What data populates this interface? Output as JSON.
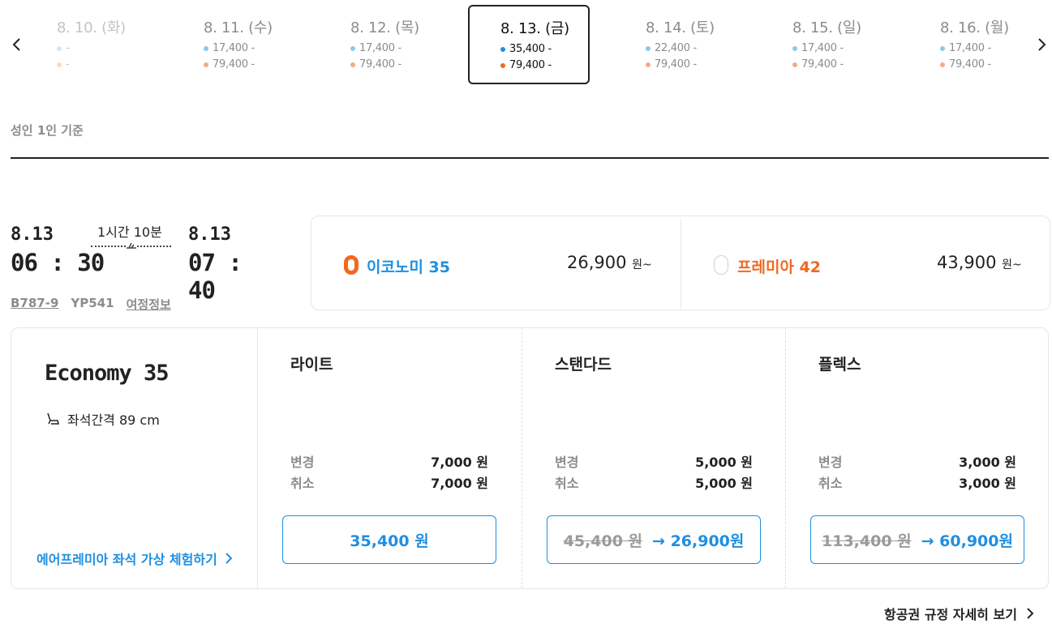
{
  "date_strip": {
    "dates": [
      {
        "label": "8. 10. (화)",
        "price1": "-",
        "price2": "-"
      },
      {
        "label": "8. 11. (수)",
        "price1": "17,400 -",
        "price2": "79,400 -"
      },
      {
        "label": "8. 12. (목)",
        "price1": "17,400 -",
        "price2": "79,400 -"
      },
      {
        "label": "8. 13. (금)",
        "price1": "35,400 -",
        "price2": "79,400 -"
      },
      {
        "label": "8. 14. (토)",
        "price1": "22,400 -",
        "price2": "79,400 -"
      },
      {
        "label": "8. 15. (일)",
        "price1": "17,400 -",
        "price2": "79,400 -"
      },
      {
        "label": "8. 16. (월)",
        "price1": "17,400 -",
        "price2": "79,400 -"
      }
    ],
    "selected_index": 3
  },
  "basis": "성인 1인 기준",
  "flight": {
    "dep_date": "8.13",
    "dep_time": "06 : 30",
    "arr_date": "8.13",
    "arr_time": "07 : 40",
    "duration": "1시간 10분",
    "aircraft": "B787-9",
    "flight_no": "YP541",
    "itinerary_link": "여정정보"
  },
  "classes": {
    "economy": {
      "name": "이코노미 35",
      "price": "26,900",
      "unit": "원~",
      "color": "#1e8fe1"
    },
    "premium": {
      "name": "프레미아 42",
      "price": "43,900",
      "unit": "원~",
      "color": "#f2681f"
    }
  },
  "fare_panel": {
    "title": "Economy 35",
    "seat_pitch": "좌석간격 89 cm",
    "vr_link": "에어프레미아 좌석 가상 체험하기",
    "change_label": "변경",
    "cancel_label": "취소",
    "fares": [
      {
        "name": "라이트",
        "change_fee": "7,000 원",
        "cancel_fee": "7,000 원",
        "old_price": "",
        "price": "35,400 원"
      },
      {
        "name": "스탠다드",
        "change_fee": "5,000 원",
        "cancel_fee": "5,000 원",
        "old_price": "45,400 원",
        "price": "→ 26,900원"
      },
      {
        "name": "플렉스",
        "change_fee": "3,000 원",
        "cancel_fee": "3,000 원",
        "old_price": "113,400 원",
        "price": "→ 60,900원"
      }
    ]
  },
  "rules_link": "항공권 규정 자세히 보기"
}
